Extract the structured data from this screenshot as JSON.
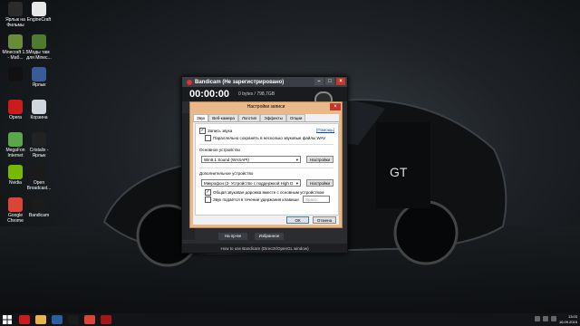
{
  "desktop": {
    "icons": [
      {
        "label": "Ярлык на Фильмы",
        "color": "#2b2b2b"
      },
      {
        "label": "EngineCraft",
        "color": "#e7e7e7"
      },
      {
        "label": "Minecraft 1.5 - Маб...",
        "color": "#6a8b3a"
      },
      {
        "label": "Моды там для Minec...",
        "color": "#4f7a2f"
      },
      {
        "label": "",
        "color": "#111111"
      },
      {
        "label": "Ярлык",
        "color": "#3b5a9a"
      },
      {
        "label": "Opera",
        "color": "#cc1b1b"
      },
      {
        "label": "Корзина",
        "color": "#cfd6de"
      },
      {
        "label": "MegaFon Internet",
        "color": "#5aa648"
      },
      {
        "label": "Cristalix - Ярлык",
        "color": "#222222"
      },
      {
        "label": "Nvidia",
        "color": "#76b900"
      },
      {
        "label": "Open Broadcast...",
        "color": "#1a1a1a"
      },
      {
        "label": "Google Chrome",
        "color": "#db4437"
      },
      {
        "label": "Bandicam",
        "color": "#1b1b1b"
      }
    ]
  },
  "bandicam": {
    "title": "Bandicam (Не зарегистрировано)",
    "timer": "00:00:00",
    "size": "0 bytes / 798,7GB",
    "help_btn": "На пр-ве",
    "fav_btn": "Избранное",
    "footer": "How to use Bandicam (DirectX/OpenGL window)"
  },
  "dialog": {
    "title": "Настройки записи",
    "tabs": [
      "Звук",
      "Веб-камера",
      "Логотип",
      "Эффекты",
      "Опции"
    ],
    "active_tab": "Звук",
    "record_sound": "Запись звука",
    "help_link": "[Помощь]",
    "parallel_save": "Параллельно сохранять в несколько звуковые файлы WAV",
    "main_device_label": "Основное устройство",
    "main_device_value": "Win8.1 Sound (WASAPI)",
    "settings_btn_1": "Настройки",
    "extra_device_label": "Дополнительное устройство",
    "extra_device_value": "Микрофон (2- Устройство с поддержкой High D",
    "settings_btn_2": "Настройки",
    "mix_track": "Общая звуковая дорожка вместе с основным устройством",
    "push_to_talk": "Звук подаётся в течение удержания клавиши",
    "hotkey_value": "Space",
    "ok_btn": "ОК",
    "cancel_btn": "Отмена"
  },
  "taskbar": {
    "apps": [
      {
        "name": "opera",
        "color": "#cc1b1b"
      },
      {
        "name": "explorer",
        "color": "#e8b54a"
      },
      {
        "name": "photoshop",
        "color": "#2a5f9e"
      },
      {
        "name": "bandicam-task",
        "color": "#1b1b1b"
      },
      {
        "name": "chrome",
        "color": "#db4437"
      },
      {
        "name": "bandicam-active",
        "color": "#a01818"
      }
    ],
    "time": "13:03",
    "date": "16.09.2015"
  }
}
